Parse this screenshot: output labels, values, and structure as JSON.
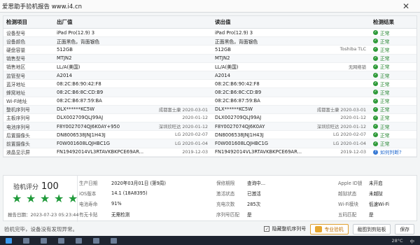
{
  "window": {
    "title": "爱思助手验机报告 www.i4.cn",
    "close": "✕"
  },
  "table": {
    "headers": [
      "检测项目",
      "出厂值",
      "读出值",
      "检测结果"
    ],
    "rows": [
      {
        "label": "设备型号",
        "factory": "iPad Pro(12.9) 3",
        "factory_sub": "",
        "read": "iPad Pro(12.9) 3",
        "read_sub": "",
        "result": "正常",
        "type": "ok"
      },
      {
        "label": "设备颜色",
        "factory": "正面黑色，背面银色",
        "factory_sub": "",
        "read": "正面黑色，背面银色",
        "read_sub": "",
        "result": "正常",
        "type": "ok"
      },
      {
        "label": "硬盘容量",
        "factory": "512GB",
        "factory_sub": "",
        "read": "512GB",
        "read_sub": "Toshiba TLC",
        "result": "正常",
        "type": "ok"
      },
      {
        "label": "销售型号",
        "factory": "MTJN2",
        "factory_sub": "",
        "read": "MTJN2",
        "read_sub": "",
        "result": "正常",
        "type": "ok"
      },
      {
        "label": "销售地区",
        "factory": "LL/A(美国)",
        "factory_sub": "",
        "read": "LL/A(美国)",
        "read_sub": "无网络锁",
        "result": "正常",
        "type": "ok"
      },
      {
        "label": "监管型号",
        "factory": "A2014",
        "factory_sub": "",
        "read": "A2014",
        "read_sub": "",
        "result": "正常",
        "type": "ok"
      },
      {
        "label": "蓝牙地址",
        "factory": "08:2C:B6:90:42:F8",
        "factory_sub": "",
        "read": "08:2C:B6:90:42:F8",
        "read_sub": "",
        "result": "正常",
        "type": "ok"
      },
      {
        "label": "蜂窝地址",
        "factory": "08:2C:B6:8C:CD:B9",
        "factory_sub": "",
        "read": "08:2C:B6:8C:CD:B9",
        "read_sub": "",
        "result": "正常",
        "type": "ok"
      },
      {
        "label": "Wi-Fi地址",
        "factory": "08:2C:B6:87:59:BA",
        "factory_sub": "",
        "read": "08:2C:B6:87:59:BA",
        "read_sub": "",
        "result": "正常",
        "type": "ok"
      },
      {
        "label": "整机序列号",
        "factory": "DLX******KC5W",
        "factory_sub": "成都富士康 2020-03-01",
        "read": "DLX******KC5W",
        "read_sub": "成都富士康 2020-03-01",
        "result": "正常",
        "type": "ok"
      },
      {
        "label": "主板序列号",
        "factory": "DLX002709QLJ99AJ",
        "factory_sub": "2020-01-12",
        "read": "DLX002709QLJ99AJ",
        "read_sub": "2020-01-12",
        "result": "正常",
        "type": "ok"
      },
      {
        "label": "电池序列号",
        "factory": "F8Y0027074QJ6K0AY+950",
        "factory_sub": "深圳欣旺达 2020-01-12",
        "read": "F8Y0027074QJ6K0AY",
        "read_sub": "深圳欣旺达 2020-01-12",
        "result": "正常",
        "type": "ok"
      },
      {
        "label": "后置摄像头",
        "factory": "DN8006538JNJ1H43J",
        "factory_sub": "LG 2020-02-07",
        "read": "DN8006538JNJ1H43J",
        "read_sub": "LG 2020-02-07",
        "result": "正常",
        "type": "ok"
      },
      {
        "label": "前置摄像头",
        "factory": "F0W001608LQJHBC1G",
        "factory_sub": "LG 2020-01-04",
        "read": "F0W001608LQJHBC1G",
        "read_sub": "LG 2020-01-04",
        "result": "正常",
        "type": "ok"
      },
      {
        "label": "液晶显示屏",
        "factory": "FN19492014VL3RTAVKBKPCE69AR...",
        "factory_sub": "2019-12-03",
        "read": "FN19492014VL3RTAVKBKPCE69AR...",
        "read_sub": "2019-12-03",
        "result": "如何判断?",
        "type": "question"
      }
    ]
  },
  "score": {
    "label": "验机评分",
    "value": "100",
    "stars": 5,
    "report_date": "报告日期：2023-07-23 05:23:44"
  },
  "info": [
    [
      "生产日期",
      "2020年03月01日 (第9周)",
      "保修期限",
      "查询中...",
      "Apple ID锁",
      "未开启"
    ],
    [
      "iOS版本",
      "14.1 (18A8395)",
      "激活状态",
      "已激活",
      "越狱状态",
      "未越狱"
    ],
    [
      "电池寿命",
      "91%",
      "充电次数",
      "285次",
      "Wi-Fi模块",
      "低速Wi-Fi"
    ],
    [
      "有无卡贴",
      "无需检测",
      "序列号匹配",
      "是",
      "五码匹配",
      "是"
    ]
  ],
  "footer": {
    "status": "验机完毕，设备没有发现异常。",
    "hide_serial": "隐藏整机序列号",
    "pro_check": "专业验机",
    "screenshot_copy": "截图到剪贴板",
    "save": "保存"
  },
  "taskbar": {
    "temp": "28°C",
    "lang": "中"
  }
}
